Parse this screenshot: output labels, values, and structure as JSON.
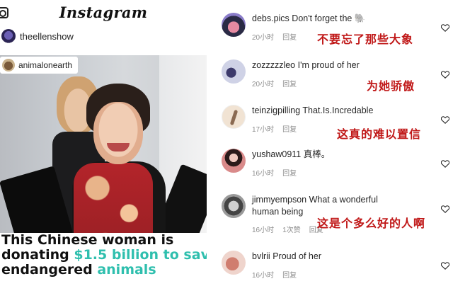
{
  "post": {
    "app_name": "Instagram",
    "account": "theellenshow",
    "photo_credit": "animalonearth",
    "caption": {
      "line1": "This Chinese woman is",
      "line2_pre": "donating ",
      "line2_amount": "$1.5 billion to save",
      "line3_pre": "endangered ",
      "line3_word": "animals"
    }
  },
  "comments": [
    {
      "user": "debs.pics",
      "text": "Don't forget the 🐘",
      "time": "20小时",
      "reply": "回复",
      "likes": "",
      "translation": "不要忘了那些大象"
    },
    {
      "user": "zozzzzzleo",
      "text": "I'm proud of her",
      "time": "20小时",
      "reply": "回复",
      "likes": "",
      "translation": "为她骄傲"
    },
    {
      "user": "teinzigpilling",
      "text": "That.Is.Incredable",
      "time": "17小时",
      "reply": "回复",
      "likes": "",
      "translation": "这真的难以置信"
    },
    {
      "user": "yushaw0911",
      "text": "真棒。",
      "time": "16小时",
      "reply": "回复",
      "likes": "",
      "translation": ""
    },
    {
      "user": "jimmyempson",
      "text": "What a wonderful human being",
      "time": "16小时",
      "reply": "回复",
      "likes": "1次赞",
      "translation": "这是个多么好的人啊"
    },
    {
      "user": "bvlrii",
      "text": "Proud of her",
      "time": "16小时",
      "reply": "回复",
      "likes": "",
      "translation": ""
    }
  ],
  "icons": {
    "heart": "heart-outline-icon",
    "camera": "camera-icon"
  },
  "colors": {
    "caption_highlight": "#2fbfae",
    "translation_red": "#c01818",
    "meta_gray": "#8e8e8e"
  }
}
